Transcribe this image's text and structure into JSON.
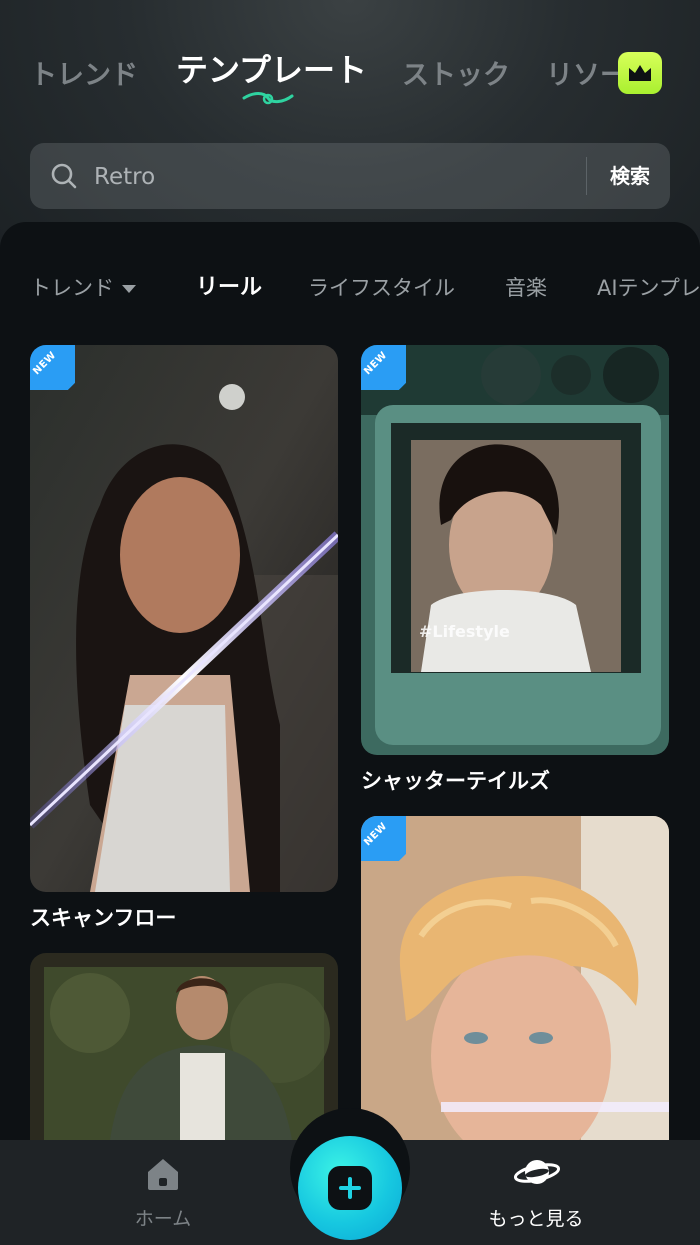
{
  "top_tabs": [
    {
      "label": "トレンド",
      "active": false
    },
    {
      "label": "テンプレート",
      "active": true
    },
    {
      "label": "ストック",
      "active": false
    },
    {
      "label": "リソー",
      "active": false
    }
  ],
  "premium_icon": "crown-icon",
  "search": {
    "placeholder": "Retro",
    "button_label": "検索",
    "icon": "search-icon"
  },
  "categories": [
    {
      "label": "トレンド",
      "has_dropdown": true,
      "active": false
    },
    {
      "label": "リール",
      "active": true
    },
    {
      "label": "ライフスタイル",
      "active": false
    },
    {
      "label": "音楽",
      "active": false
    },
    {
      "label": "AIテンプレ",
      "active": false
    }
  ],
  "cards": [
    {
      "title": "スキャンフロー",
      "badge": "NEW"
    },
    {
      "title": "シャッターテイルズ",
      "badge": "NEW",
      "overlay_text": "#Lifestyle"
    },
    {
      "title": "",
      "badge": "NEW"
    },
    {
      "title": "",
      "badge": ""
    }
  ],
  "bottom_nav": {
    "home": {
      "label": "ホーム",
      "icon": "home-icon"
    },
    "create": {
      "icon": "plus-icon"
    },
    "more": {
      "label": "もっと見る",
      "icon": "planet-icon"
    }
  },
  "colors": {
    "accent_cyan": "#1fd3e4",
    "premium_green": "#b8f53c",
    "badge_blue": "#2a9df4",
    "background": "#0d1114"
  }
}
